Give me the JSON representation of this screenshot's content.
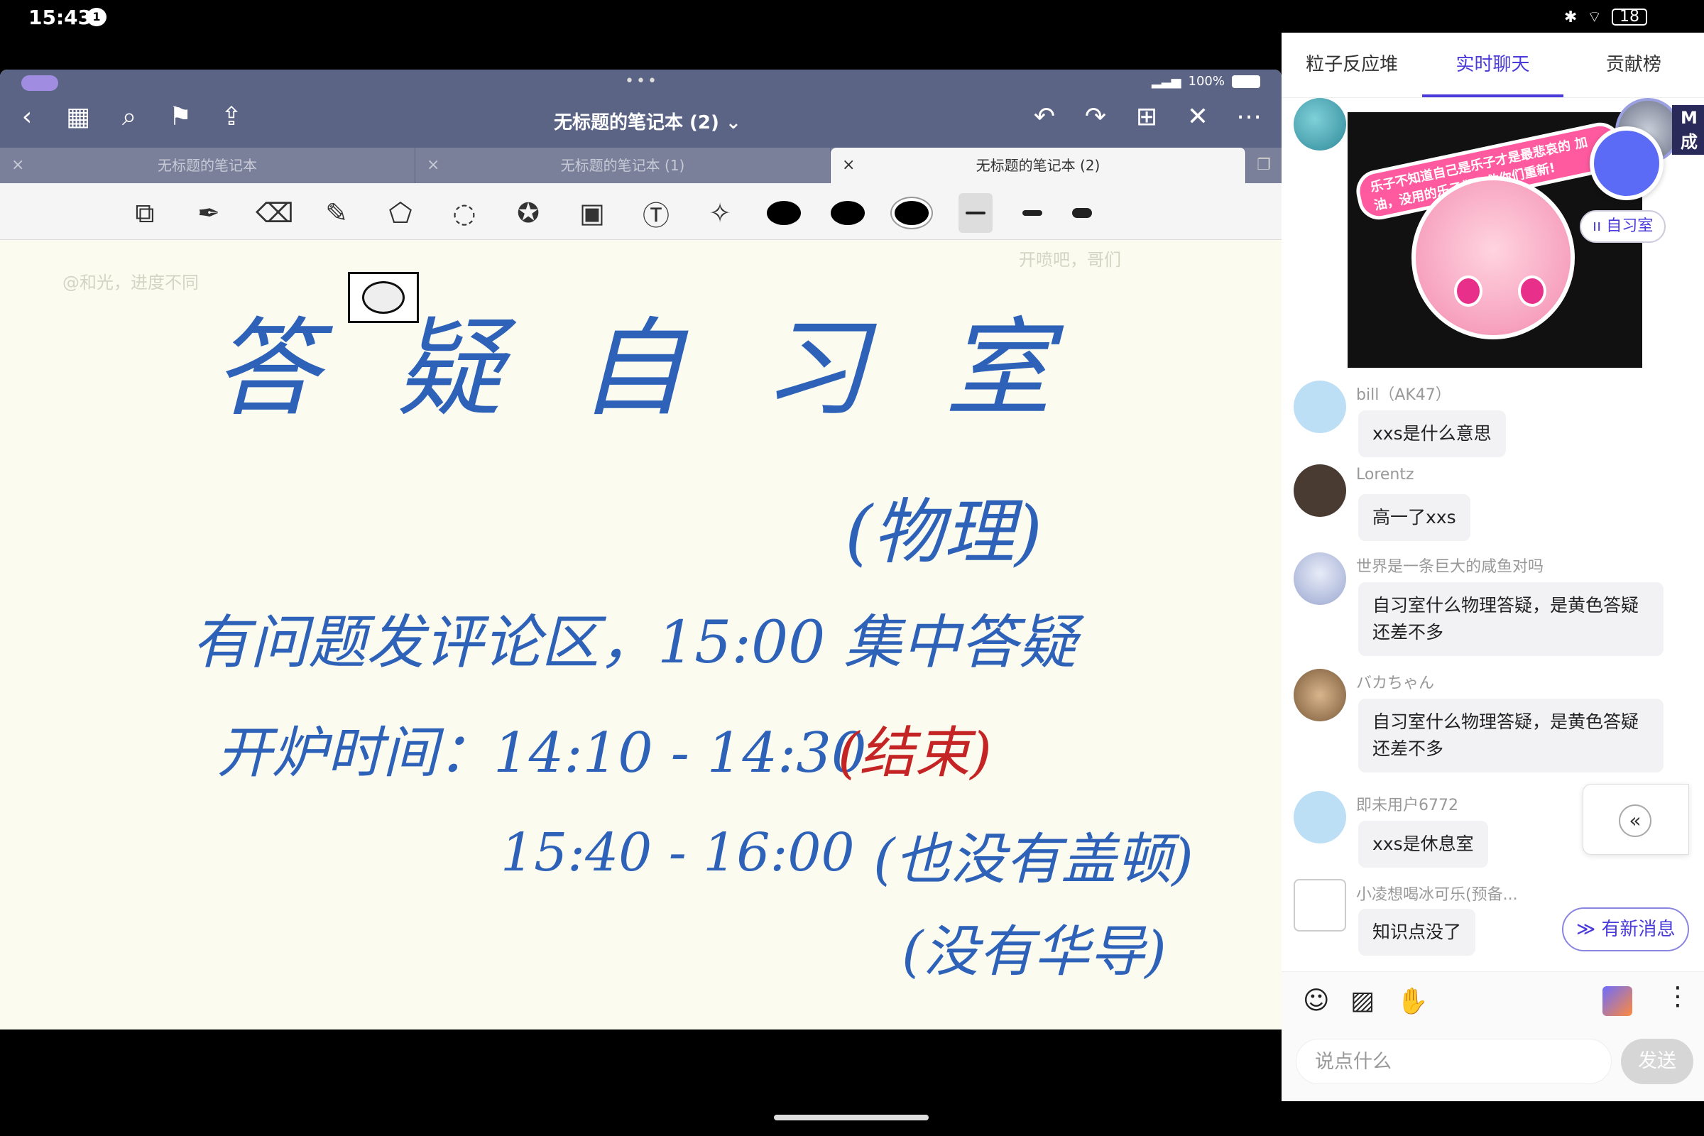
{
  "status": {
    "time": "15:43",
    "notif": "1",
    "battery": "18",
    "bt": "✱",
    "wifi": "⌔"
  },
  "notebook": {
    "title": "无标题的笔记本 (2) ⌄",
    "battery_text": "100%",
    "tabs": [
      {
        "label": "无标题的笔记本"
      },
      {
        "label": "无标题的笔记本 (1)"
      },
      {
        "label": "无标题的笔记本 (2)"
      }
    ],
    "ghost_text_left": "@和光，进度不同",
    "ghost_text_right": "开喷吧，哥们",
    "handwriting": {
      "title": "答 疑 自 习 室",
      "subtitle": "(物理)",
      "line1": "有问题发评论区，15:00 集中答疑",
      "line2_main": "开炉时间：14:10 - 14:30",
      "line2_red": "(结束)",
      "line3_time": "15:40 - 16:00",
      "line3_note": "(也没有盖顿)",
      "line4_note": "(没有华导)"
    }
  },
  "chat": {
    "tabs": [
      {
        "label": "粒子反应堆"
      },
      {
        "label": "实时聊天"
      },
      {
        "label": "贡献榜"
      }
    ],
    "sticker_banner": "乐子不知道自己是乐子才是最悲哀的 加油，没用的乐子们，救你们重新!",
    "float_name": "M\n成",
    "room_label": "ıı 自习室",
    "messages": [
      {
        "user": "bill（AK47）",
        "text": "xxs是什么意思"
      },
      {
        "user": "Lorentz",
        "text": "高一了xxs"
      },
      {
        "user": "世界是一条巨大的咸鱼对吗",
        "text": "自习室什么物理答疑，是黄色答疑还差不多"
      },
      {
        "user": "バカちゃん",
        "text": "自习室什么物理答疑，是黄色答疑还差不多"
      },
      {
        "user": "即未用户6772",
        "text": "xxs是休息室"
      },
      {
        "user": "小凌想喝冰可乐(预备...",
        "text": "知识点没了"
      }
    ],
    "new_message_btn": "≫ 有新消息",
    "collapse_icon": "«",
    "input_placeholder": "说点什么",
    "send_label": "发送"
  }
}
